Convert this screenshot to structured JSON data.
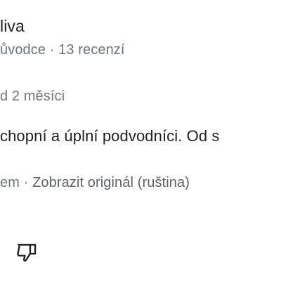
{
  "review": {
    "author_fragment": "liva",
    "meta_fragment": "ůvodce · 13 recenzí",
    "date_fragment": "d 2 měsíci",
    "text_fragment": "chopní a úplní podvodníci. Od s",
    "translate_prefix": "em · ",
    "translate_link": "Zobrazit originál (ruština)"
  },
  "actions": {
    "dislike_icon": "thumbs-down-icon"
  }
}
